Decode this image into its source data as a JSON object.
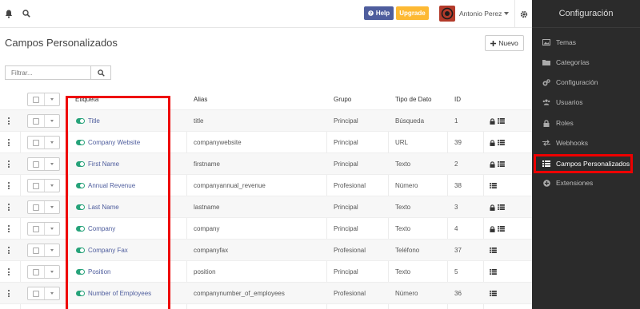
{
  "topbar": {
    "help_label": "Help",
    "upgrade_label": "Upgrade",
    "user_name": "Antonio Perez",
    "colors": {
      "help": "#4e5d9d",
      "upgrade": "#fdb933"
    }
  },
  "sidebar": {
    "title": "Configuración",
    "items": [
      {
        "label": "Temas",
        "icon": "image-icon"
      },
      {
        "label": "Categorías",
        "icon": "folder-icon"
      },
      {
        "label": "Configuración",
        "icon": "cogs-icon"
      },
      {
        "label": "Usuarios",
        "icon": "users-icon"
      },
      {
        "label": "Roles",
        "icon": "lock-icon"
      },
      {
        "label": "Webhooks",
        "icon": "exchange-icon"
      },
      {
        "label": "Campos Personalizados",
        "icon": "list-icon",
        "active": true
      },
      {
        "label": "Extensiones",
        "icon": "plus-circle-icon"
      }
    ]
  },
  "main": {
    "title": "Campos Personalizados",
    "new_button": "Nuevo",
    "filter_placeholder": "Filtrar..."
  },
  "table": {
    "columns": [
      "Etiqueta",
      "Alias",
      "Grupo",
      "Tipo de Dato",
      "ID"
    ],
    "rows": [
      {
        "label": "Title",
        "alias": "title",
        "group": "Principal",
        "type": "Búsqueda",
        "id": "1",
        "locked": true
      },
      {
        "label": "Company Website",
        "alias": "companywebsite",
        "group": "Principal",
        "type": "URL",
        "id": "39",
        "locked": true
      },
      {
        "label": "First Name",
        "alias": "firstname",
        "group": "Principal",
        "type": "Texto",
        "id": "2",
        "locked": true
      },
      {
        "label": "Annual Revenue",
        "alias": "companyannual_revenue",
        "group": "Profesional",
        "type": "Número",
        "id": "38",
        "locked": false
      },
      {
        "label": "Last Name",
        "alias": "lastname",
        "group": "Principal",
        "type": "Texto",
        "id": "3",
        "locked": true
      },
      {
        "label": "Company",
        "alias": "company",
        "group": "Principal",
        "type": "Texto",
        "id": "4",
        "locked": true
      },
      {
        "label": "Company Fax",
        "alias": "companyfax",
        "group": "Profesional",
        "type": "Teléfono",
        "id": "37",
        "locked": false
      },
      {
        "label": "Position",
        "alias": "position",
        "group": "Principal",
        "type": "Texto",
        "id": "5",
        "locked": false
      },
      {
        "label": "Number of Employees",
        "alias": "companynumber_of_employees",
        "group": "Profesional",
        "type": "Número",
        "id": "36",
        "locked": false
      }
    ]
  }
}
